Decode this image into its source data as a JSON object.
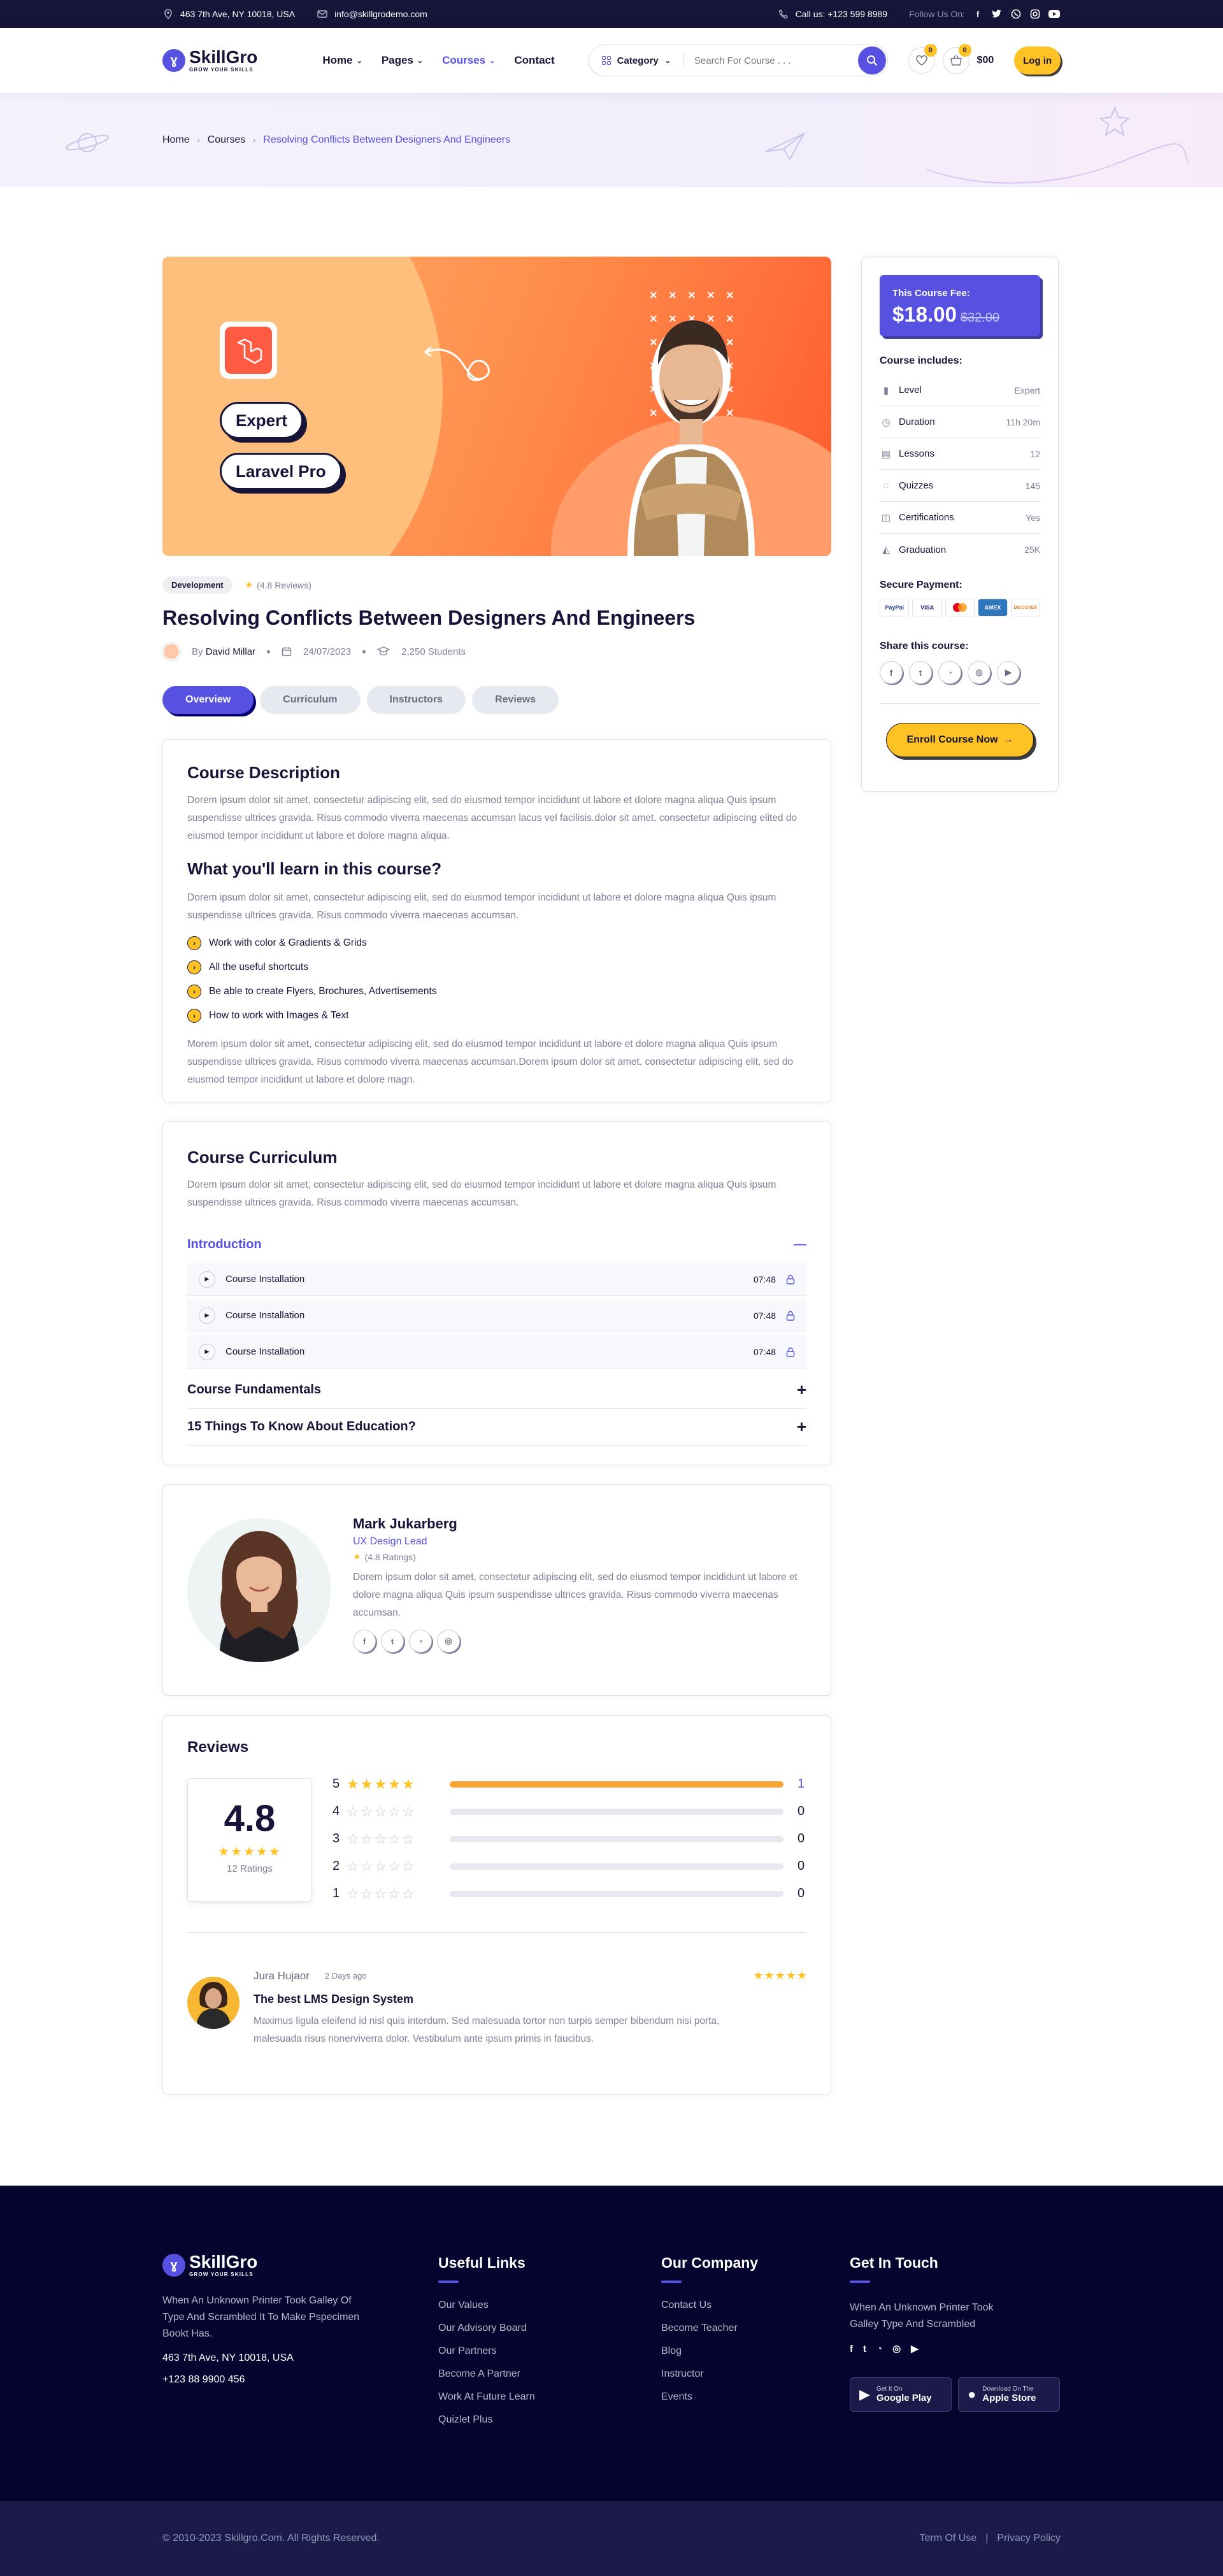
{
  "topbar": {
    "address": "463 7th Ave, NY 10018, USA",
    "email": "info@skillgrodemo.com",
    "phone": "Call us: +123 599 8989",
    "follow": "Follow Us On:"
  },
  "header": {
    "brand": "SkillGro",
    "tagline": "GROW YOUR SKILLS",
    "nav": [
      {
        "label": "Home",
        "dropdown": true
      },
      {
        "label": "Pages",
        "dropdown": true
      },
      {
        "label": "Courses",
        "dropdown": true,
        "active": true
      },
      {
        "label": "Contact",
        "dropdown": false
      }
    ],
    "category": "Category",
    "search_placeholder": "Search For Course . . .",
    "wishlist_count": "0",
    "cart_count": "0",
    "cart_total": "$00",
    "login": "Log in"
  },
  "breadcrumb": {
    "home": "Home",
    "courses": "Courses",
    "current": "Resolving Conflicts Between Designers And Engineers"
  },
  "course": {
    "banner_labels": [
      "Expert",
      "Laravel Pro"
    ],
    "tag": "Development",
    "reviews": "(4.8 Reviews)",
    "title": "Resolving Conflicts Between Designers And Engineers",
    "by": "By",
    "author": "David Millar",
    "date": "24/07/2023",
    "students": "2,250 Students"
  },
  "tabs": [
    "Overview",
    "Curriculum",
    "Instructors",
    "Reviews"
  ],
  "overview": {
    "title": "Course Description",
    "desc": "Dorem ipsum dolor sit amet, consectetur adipiscing elit, sed do eiusmod tempor incididunt ut labore et dolore magna aliqua Quis ipsum suspendisse ultrices gravida. Risus commodo viverra maecenas accumsan lacus vel facilisis.dolor sit amet, consectetur adipiscing elited do eiusmod tempor incididunt ut labore et dolore magna aliqua.",
    "learn_title": "What you'll learn in this course?",
    "learn_desc": "Dorem ipsum dolor sit amet, consectetur adipiscing elit, sed do eiusmod tempor incididunt ut labore et dolore magna aliqua Quis ipsum suspendisse ultrices gravida. Risus commodo viverra maecenas accumsan.",
    "learn_items": [
      "Work with color & Gradients & Grids",
      "All the useful shortcuts",
      "Be able to create Flyers, Brochures, Advertisements",
      "How to work with Images & Text"
    ],
    "outro": "Morem ipsum dolor sit amet, consectetur adipiscing elit, sed do eiusmod tempor incididunt ut labore et dolore magna aliqua Quis ipsum suspendisse ultrices gravida. Risus commodo viverra maecenas accumsan.Dorem ipsum dolor sit amet, consectetur adipiscing elit, sed do eiusmod tempor incididunt ut labore et dolore magn."
  },
  "curriculum": {
    "title": "Course Curriculum",
    "desc": "Dorem ipsum dolor sit amet, consectetur adipiscing elit, sed do eiusmod tempor incididunt ut labore et dolore magna aliqua Quis ipsum suspendisse ultrices gravida. Risus commodo viverra maecenas accumsan.",
    "open_section": "Introduction",
    "lessons": [
      {
        "title": "Course Installation",
        "duration": "07:48"
      },
      {
        "title": "Course Installation",
        "duration": "07:48"
      },
      {
        "title": "Course Installation",
        "duration": "07:48"
      }
    ],
    "sections": [
      "Course Fundamentals",
      "15 Things To Know About Education?"
    ]
  },
  "instructor": {
    "name": "Mark Jukarberg",
    "role": "UX Design Lead",
    "ratings": "(4.8 Ratings)",
    "bio": "Dorem ipsum dolor sit amet, consectetur adipiscing elit, sed do eiusmod tempor incididunt ut labore et dolore magna aliqua Quis ipsum suspendisse ultrices gravida. Risus commodo viverra maecenas accumsan."
  },
  "reviews": {
    "title": "Reviews",
    "average": "4.8",
    "count": "12 Ratings",
    "breakdown": [
      {
        "stars": "5",
        "count": "1",
        "fraction": 1.0
      },
      {
        "stars": "4",
        "count": "0",
        "fraction": 0
      },
      {
        "stars": "3",
        "count": "0",
        "fraction": 0
      },
      {
        "stars": "2",
        "count": "0",
        "fraction": 0
      },
      {
        "stars": "1",
        "count": "0",
        "fraction": 0
      }
    ],
    "item": {
      "author": "Jura Hujaor",
      "when": "2 Days ago",
      "headline": "The best LMS Design System",
      "body": "Maximus ligula eleifend id nisl quis interdum. Sed malesuada tortor non turpis semper bibendum nisi porta, malesuada risus nonerviverra dolor. Vestibulum ante ipsum primis in faucibus."
    }
  },
  "sidebar": {
    "fee_label": "This Course Fee:",
    "price": "$18.00",
    "old_price": "$32.00",
    "includes_title": "Course includes:",
    "includes": [
      {
        "label": "Level",
        "value": "Expert"
      },
      {
        "label": "Duration",
        "value": "11h 20m"
      },
      {
        "label": "Lessons",
        "value": "12"
      },
      {
        "label": "Quizzes",
        "value": "145"
      },
      {
        "label": "Certifications",
        "value": "Yes"
      },
      {
        "label": "Graduation",
        "value": "25K"
      }
    ],
    "payment_title": "Secure Payment:",
    "payments": [
      "PayPal",
      "VISA",
      "MC",
      "AMEX",
      "DISCOVER"
    ],
    "share_title": "Share this course:",
    "enroll": "Enroll Course Now"
  },
  "footer": {
    "about": "When An Unknown Printer Took Galley Of Type And Scrambled It To Make Pspecimen Bookt Has.",
    "address": "463 7th Ave, NY 10018, USA",
    "phone": "+123 88 9900 456",
    "useful_title": "Useful Links",
    "useful": [
      "Our Values",
      "Our Advisory Board",
      "Our Partners",
      "Become A Partner",
      "Work At Future Learn",
      "Quizlet Plus"
    ],
    "company_title": "Our Company",
    "company": [
      "Contact Us",
      "Become Teacher",
      "Blog",
      "Instructor",
      "Events"
    ],
    "touch_title": "Get In Touch",
    "touch_text": "When An Unknown Printer Took Galley  Type And Scrambled",
    "google_small": "Get It On",
    "google": "Google Play",
    "apple_small": "Download On The",
    "apple": "Apple Store",
    "copyright": "© 2010-2023 Skillgro.Com. All Rights Reserved.",
    "terms": "Term Of Use",
    "privacy": "Privacy Policy"
  },
  "colors": {
    "primary": "#5751e1",
    "accent": "#ffc224",
    "dark": "#161439",
    "footer": "#06042e"
  }
}
